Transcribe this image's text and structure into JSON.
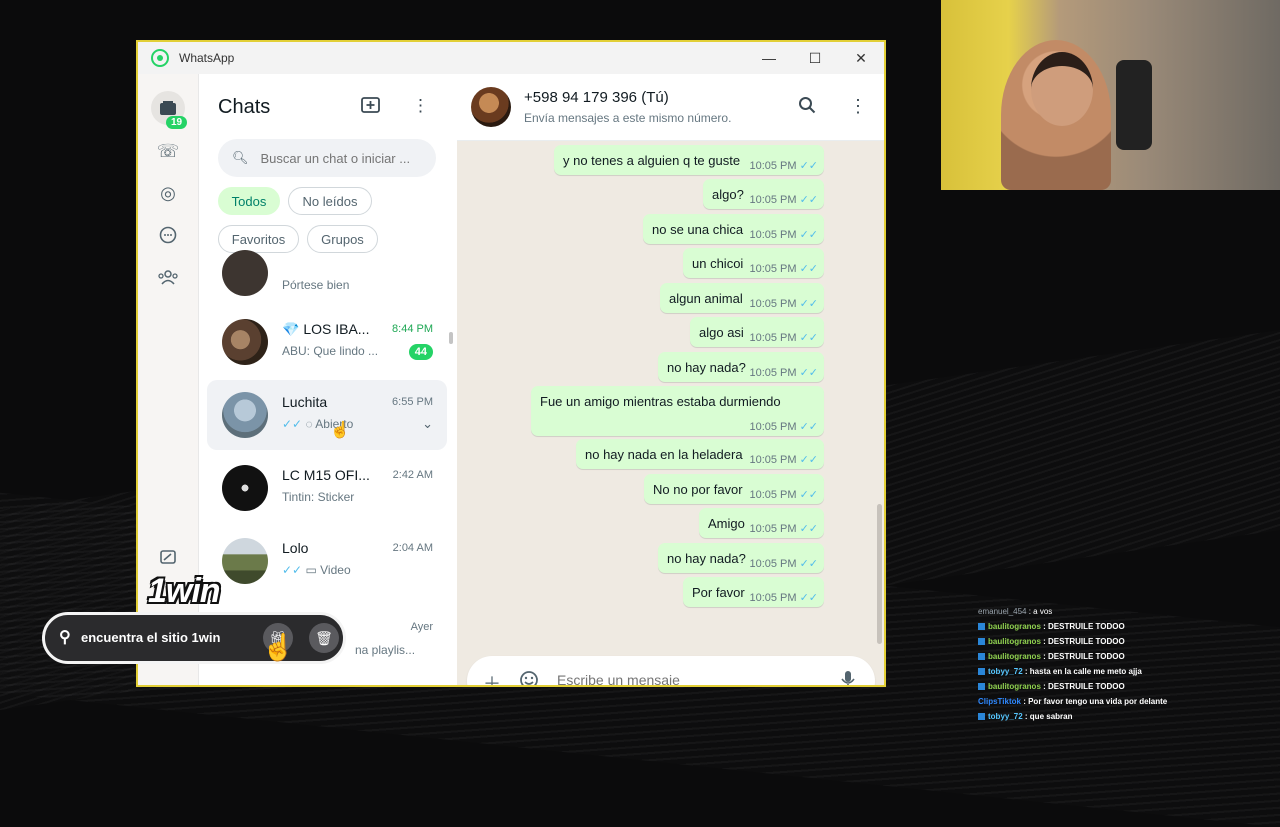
{
  "window": {
    "title": "WhatsApp",
    "minimize": "—",
    "maximize": "☐",
    "close": "✕"
  },
  "rail": {
    "badge": "19"
  },
  "chats": {
    "title": "Chats",
    "search_placeholder": "Buscar un chat o iniciar ...",
    "filters": [
      "Todos",
      "No leídos",
      "Favoritos",
      "Grupos"
    ],
    "items": [
      {
        "name": "",
        "preview": "Pórtese bien",
        "time": ""
      },
      {
        "name": "💎 LOS IBA...",
        "preview": "ABU: Que  lindo ...",
        "time": "8:44 PM",
        "unread": "44"
      },
      {
        "name": "Luchita",
        "preview": "Abierto",
        "time": "6:55 PM"
      },
      {
        "name": "LC M15 OFI...",
        "preview": "Tintin: Sticker",
        "time": "2:42 AM"
      },
      {
        "name": "Lolo",
        "preview": "Video",
        "time": "2:04 AM"
      },
      {
        "name": "",
        "preview": "na playlis...",
        "time": "Ayer"
      }
    ]
  },
  "conversation": {
    "name": "+598 94 179 396 (Tú)",
    "subtitle": "Envía mensajes a este mismo número.",
    "messages": [
      {
        "text": "y no tenes a alguien q te guste",
        "time": "10:05 PM"
      },
      {
        "text": "algo?",
        "time": "10:05 PM"
      },
      {
        "text": "no se una chica",
        "time": "10:05 PM"
      },
      {
        "text": "un chicoi",
        "time": "10:05 PM"
      },
      {
        "text": "algun animal",
        "time": "10:05 PM"
      },
      {
        "text": "algo asi",
        "time": "10:05 PM"
      },
      {
        "text": "no hay nada?",
        "time": "10:05 PM"
      },
      {
        "text": "Fue un amigo mientras estaba durmiendo",
        "time": "10:05 PM"
      },
      {
        "text": "no hay nada en la heladera",
        "time": "10:05 PM"
      },
      {
        "text": "No no por favor",
        "time": "10:05 PM"
      },
      {
        "text": "Amigo",
        "time": "10:05 PM"
      },
      {
        "text": "no hay nada?",
        "time": "10:05 PM"
      },
      {
        "text": "Por favor",
        "time": "10:05 PM"
      }
    ],
    "composer_placeholder": "Escribe un mensaje"
  },
  "stream_chat": [
    {
      "user": "emanuel_454",
      "msg": " : a vos"
    },
    {
      "user": "baulitogranos",
      "msg": " : DESTRUILE TODOO"
    },
    {
      "user": "baulitogranos",
      "msg": " : DESTRUILE TODOO"
    },
    {
      "user": "baulitogranos",
      "msg": " : DESTRUILE TODOO"
    },
    {
      "user": "tobyy_72",
      "msg": " : hasta en la calle me meto ajja"
    },
    {
      "user": "baulitogranos",
      "msg": " : DESTRUILE TODOO"
    },
    {
      "user": "ClipsTiktok",
      "msg": " : Por favor tengo una vida por delante"
    },
    {
      "user": "tobyy_72",
      "msg": " : que sabran"
    }
  ],
  "ad": {
    "logo": "1win",
    "text": "encuentra el sitio 1win"
  }
}
